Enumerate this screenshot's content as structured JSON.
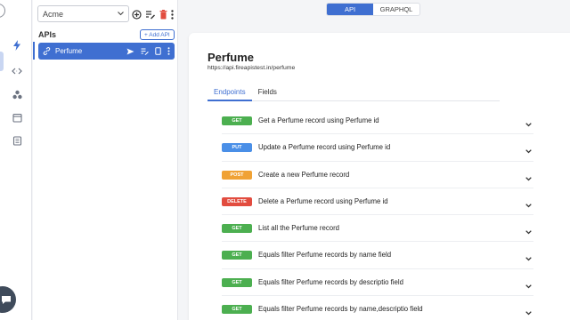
{
  "toggle": {
    "api_label": "API",
    "graphql_label": "GRAPHQL",
    "selected": "API"
  },
  "sidebar": {
    "org": "Acme",
    "apis_heading": "APIs",
    "add_api_label": "+ Add API",
    "apis": [
      {
        "name": "Perfume",
        "selected": true
      }
    ],
    "rail_icons": [
      "bolt-icon",
      "code-icon",
      "cluster-icon",
      "calendar-icon",
      "book-icon"
    ]
  },
  "main": {
    "title": "Perfume",
    "url": "https://api.fireapistest.in/perfume",
    "tabs": [
      {
        "label": "Endpoints",
        "active": true
      },
      {
        "label": "Fields",
        "active": false
      }
    ],
    "endpoints": [
      {
        "method": "GET",
        "summary": "Get a Perfume record using Perfume id"
      },
      {
        "method": "PUT",
        "summary": "Update a Perfume record using Perfume id"
      },
      {
        "method": "POST",
        "summary": "Create a new Perfume record"
      },
      {
        "method": "DELETE",
        "summary": "Delete a Perfume record using Perfume id"
      },
      {
        "method": "GET",
        "summary": "List all the Perfume record"
      },
      {
        "method": "GET",
        "summary": "Equals filter Perfume records by name field"
      },
      {
        "method": "GET",
        "summary": "Equals filter Perfume records by descriptio field"
      },
      {
        "method": "GET",
        "summary": "Equals filter Perfume records by name,descriptio field"
      }
    ]
  },
  "colors": {
    "accent": "#3f6fd1",
    "get": "#4caf50",
    "put": "#4a8fe7",
    "post": "#f0a235",
    "delete": "#e24c3f"
  }
}
